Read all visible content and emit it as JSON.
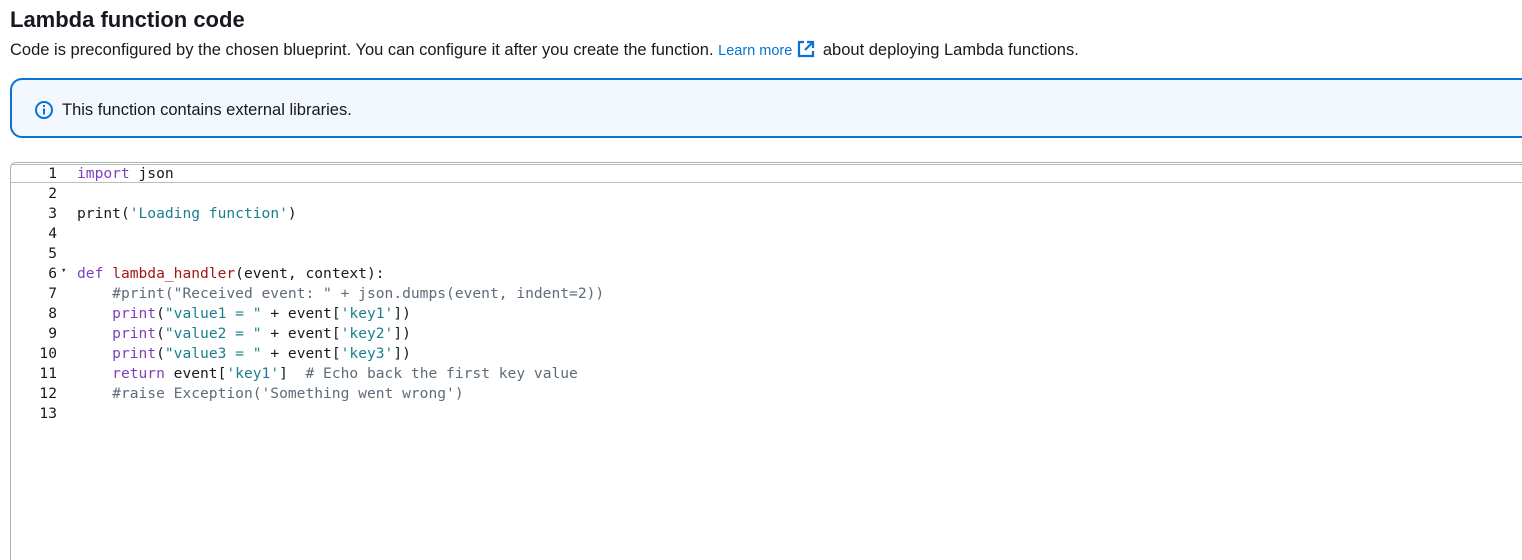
{
  "section": {
    "title": "Lambda function code",
    "description_before_link": "Code is preconfigured by the chosen blueprint. You can configure it after you create the function. ",
    "link_text": "Learn more",
    "description_after_link": " about deploying Lambda functions."
  },
  "alert": {
    "icon": "info-icon",
    "text": "This function contains external libraries."
  },
  "editor": {
    "language": "python",
    "active_line": 1,
    "lines": [
      {
        "num": "1",
        "tokens": [
          {
            "t": "import",
            "c": "kw"
          },
          {
            "t": " json",
            "c": "plain"
          }
        ]
      },
      {
        "num": "2",
        "tokens": []
      },
      {
        "num": "3",
        "tokens": [
          {
            "t": "print",
            "c": "plain"
          },
          {
            "t": "(",
            "c": "plain"
          },
          {
            "t": "'Loading function'",
            "c": "str"
          },
          {
            "t": ")",
            "c": "plain"
          }
        ]
      },
      {
        "num": "4",
        "tokens": []
      },
      {
        "num": "5",
        "tokens": []
      },
      {
        "num": "6",
        "fold": "▾",
        "tokens": [
          {
            "t": "def",
            "c": "kw"
          },
          {
            "t": " ",
            "c": "plain"
          },
          {
            "t": "lambda_handler",
            "c": "fn"
          },
          {
            "t": "(event, context):",
            "c": "plain"
          }
        ]
      },
      {
        "num": "7",
        "tokens": [
          {
            "t": "    ",
            "c": "plain"
          },
          {
            "t": "#print(\"Received event: \" + json.dumps(event, indent=2))",
            "c": "cm"
          }
        ]
      },
      {
        "num": "8",
        "tokens": [
          {
            "t": "    ",
            "c": "plain"
          },
          {
            "t": "print",
            "c": "kw"
          },
          {
            "t": "(",
            "c": "plain"
          },
          {
            "t": "\"value1 = \"",
            "c": "str"
          },
          {
            "t": " + event[",
            "c": "plain"
          },
          {
            "t": "'key1'",
            "c": "str"
          },
          {
            "t": "])",
            "c": "plain"
          }
        ]
      },
      {
        "num": "9",
        "tokens": [
          {
            "t": "    ",
            "c": "plain"
          },
          {
            "t": "print",
            "c": "kw"
          },
          {
            "t": "(",
            "c": "plain"
          },
          {
            "t": "\"value2 = \"",
            "c": "str"
          },
          {
            "t": " + event[",
            "c": "plain"
          },
          {
            "t": "'key2'",
            "c": "str"
          },
          {
            "t": "])",
            "c": "plain"
          }
        ]
      },
      {
        "num": "10",
        "tokens": [
          {
            "t": "    ",
            "c": "plain"
          },
          {
            "t": "print",
            "c": "kw"
          },
          {
            "t": "(",
            "c": "plain"
          },
          {
            "t": "\"value3 = \"",
            "c": "str"
          },
          {
            "t": " + event[",
            "c": "plain"
          },
          {
            "t": "'key3'",
            "c": "str"
          },
          {
            "t": "])",
            "c": "plain"
          }
        ]
      },
      {
        "num": "11",
        "tokens": [
          {
            "t": "    ",
            "c": "plain"
          },
          {
            "t": "return",
            "c": "kw"
          },
          {
            "t": " event[",
            "c": "plain"
          },
          {
            "t": "'key1'",
            "c": "str"
          },
          {
            "t": "]  ",
            "c": "plain"
          },
          {
            "t": "# Echo back the first key value",
            "c": "cm"
          }
        ]
      },
      {
        "num": "12",
        "tokens": [
          {
            "t": "    ",
            "c": "plain"
          },
          {
            "t": "#raise Exception('Something went wrong')",
            "c": "cm"
          }
        ]
      },
      {
        "num": "13",
        "tokens": []
      }
    ]
  },
  "colors": {
    "link": "#0972d3",
    "alert_border": "#0972d3",
    "alert_background": "#f2f8fd",
    "keyword": "#7f3fbf",
    "function_name": "#a31515",
    "string": "#1a7f8e",
    "comment": "#5f6b7a"
  }
}
